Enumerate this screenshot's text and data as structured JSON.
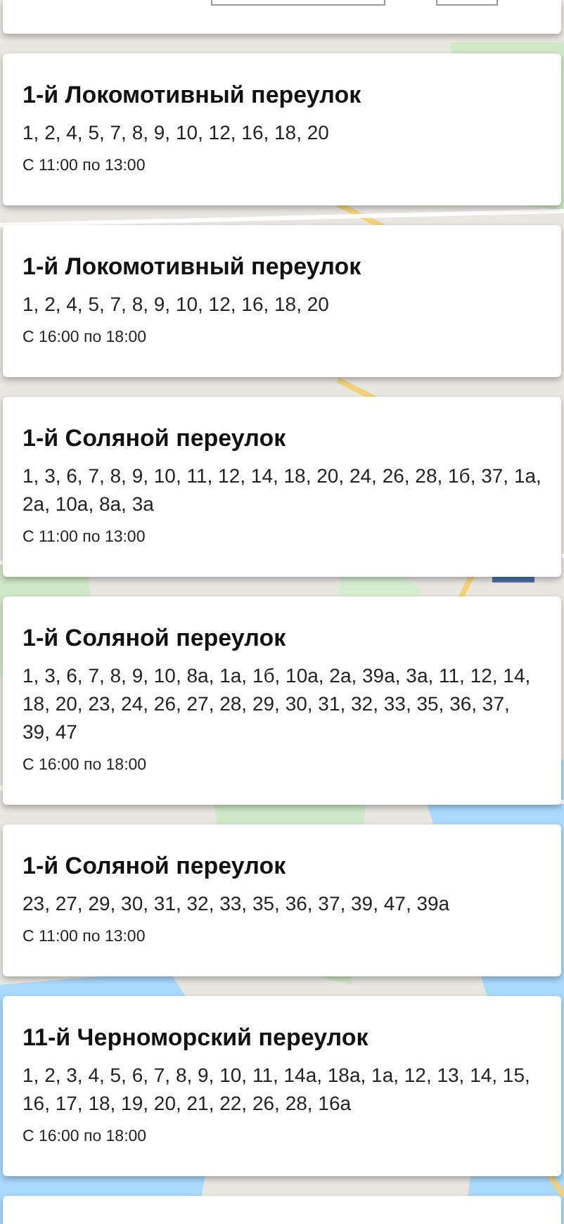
{
  "top_card": {
    "fields": [
      {
        "kind": "input"
      },
      {
        "kind": "input"
      }
    ]
  },
  "entries": [
    {
      "street": "1-й Локомотивный переулок",
      "houses": "1, 2, 4, 5, 7, 8, 9, 10, 12, 16, 18, 20",
      "time": "С 11:00 по 13:00"
    },
    {
      "street": "1-й Локомотивный переулок",
      "houses": "1, 2, 4, 5, 7, 8, 9, 10, 12, 16, 18, 20",
      "time": "С 16:00 по 18:00"
    },
    {
      "street": "1-й Соляной переулок",
      "houses": "1, 3, 6, 7, 8, 9, 10, 11, 12, 14, 18, 20, 24, 26, 28, 1б, 37, 1а, 2а, 10а, 8а, 3а",
      "time": "С 11:00 по 13:00"
    },
    {
      "street": "1-й Соляной переулок",
      "houses": "1, 3, 6, 7, 8, 9, 10, 8а, 1а, 1б, 10а, 2а, 39а, 3а, 11, 12, 14, 18, 20, 23, 24, 26, 27, 28, 29, 30, 31, 32, 33, 35, 36, 37, 39, 47",
      "time": "С 16:00 по 18:00"
    },
    {
      "street": "1-й Соляной переулок",
      "houses": "23, 27, 29, 30, 31, 32, 33, 35, 36, 37, 39, 47, 39а",
      "time": "С 11:00 по 13:00"
    },
    {
      "street": "11-й Черноморский переулок",
      "houses": "1, 2, 3, 4, 5, 6, 7, 8, 9, 10, 11, 14а, 18а, 1а, 12, 13, 14, 15, 16, 17, 18, 19, 20, 21, 22, 26, 28, 16а",
      "time": "С 16:00 по 18:00"
    }
  ]
}
